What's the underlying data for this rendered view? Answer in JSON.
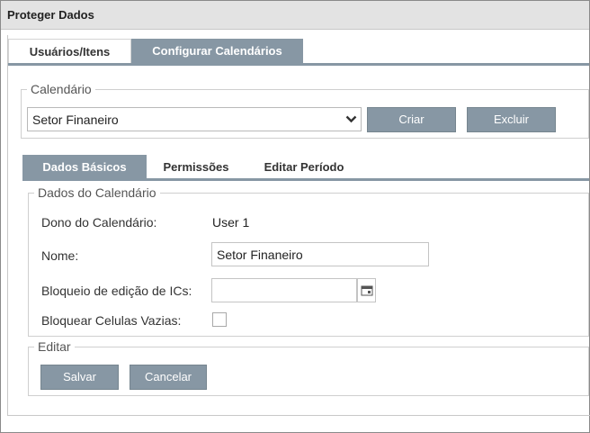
{
  "window": {
    "title": "Proteger Dados"
  },
  "top_tabs": [
    {
      "label": "Usuários/Itens"
    },
    {
      "label": "Configurar Calendários"
    }
  ],
  "calendar_group": {
    "legend": "Calendário",
    "selected": "Setor Finaneiro",
    "create_label": "Criar",
    "delete_label": "Excluir"
  },
  "inner_tabs": [
    {
      "label": "Dados Básicos"
    },
    {
      "label": "Permissões"
    },
    {
      "label": "Editar Período"
    }
  ],
  "data_group": {
    "legend": "Dados do Calendário",
    "owner_label": "Dono do Calendário:",
    "owner_value": "User 1",
    "name_label": "Nome:",
    "name_value": "Setor Finaneiro",
    "lock_label": "Bloqueio de edição de ICs:",
    "lock_value": "",
    "empty_cells_label": "Bloquear Celulas Vazias:",
    "empty_cells_checked": false
  },
  "edit_group": {
    "legend": "Editar",
    "save_label": "Salvar",
    "cancel_label": "Cancelar"
  },
  "colors": {
    "accent": "#8797a4",
    "titlebar": "#e3e3e3"
  },
  "icons": {
    "dropdown": "chevron-down-icon",
    "date_picker": "calendar-icon"
  }
}
